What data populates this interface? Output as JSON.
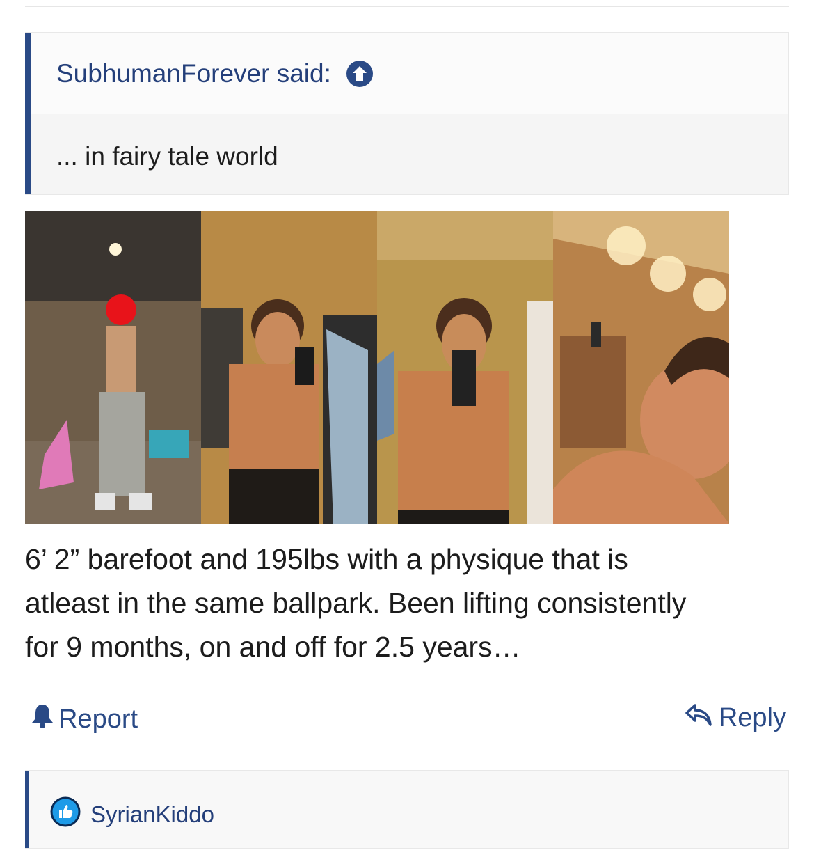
{
  "quote": {
    "author": "SubhumanForever said:",
    "text": "... in fairy tale world"
  },
  "gallery": {
    "photos": [
      "basement-gym-photo",
      "mirror-selfie-side",
      "mirror-selfie-front",
      "bathroom-selfie"
    ]
  },
  "post": {
    "lines": [
      "6’ 2” barefoot and 195lbs with a physique that is",
      "atleast in the same ballpark. Been lifting consistently",
      "for 9 months, on and off for 2.5 years…"
    ]
  },
  "actions": {
    "report_label": "Report",
    "reply_label": "Reply"
  },
  "next_post": {
    "username": "SyrianKiddo"
  },
  "colors": {
    "accent": "#2a4a86",
    "avatar": "#1e9be8"
  },
  "icons": {
    "jump_to_quote": "arrow-up-circle-icon",
    "report": "bell-icon",
    "reply": "reply-arrow-icon",
    "user_badge": "thumbs-up-icon"
  }
}
